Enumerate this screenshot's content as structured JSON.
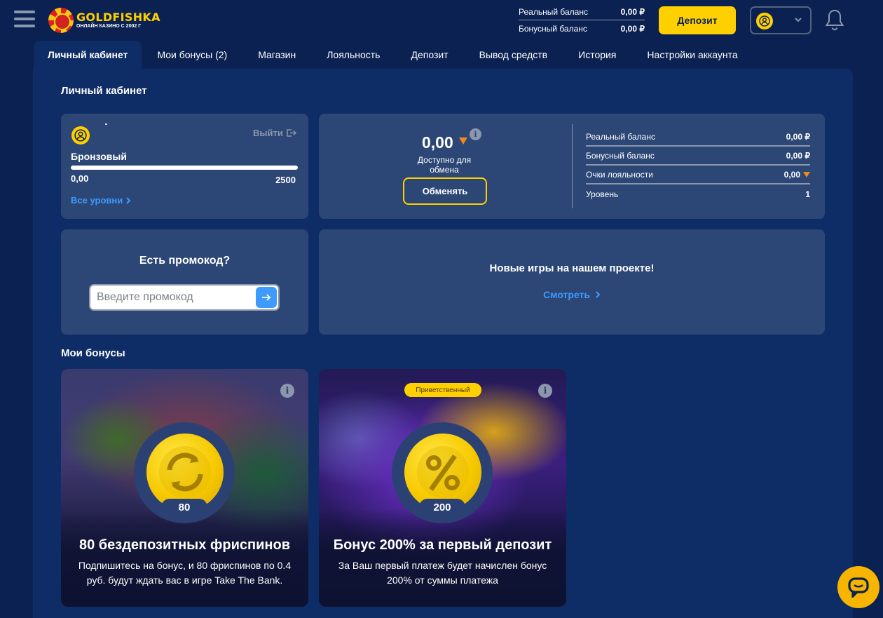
{
  "header": {
    "logo_name": "GOLDFISHKA",
    "logo_sub": "ОНЛАЙН КАЗИНО С 2002 Г",
    "real_balance_label": "Реальный баланс",
    "real_balance_value": "0,00 ₽",
    "bonus_balance_label": "Бонусный баланс",
    "bonus_balance_value": "0,00 ₽",
    "deposit_label": "Депозит"
  },
  "tabs": [
    {
      "label": "Личный кабинет",
      "active": true
    },
    {
      "label": "Мои бонусы (2)"
    },
    {
      "label": "Магазин"
    },
    {
      "label": "Лояльность"
    },
    {
      "label": "Депозит"
    },
    {
      "label": "Вывод средств"
    },
    {
      "label": "История"
    },
    {
      "label": "Настройки аккаунта"
    }
  ],
  "cabinet": {
    "title": "Личный кабинет",
    "logout_label": "Выйти",
    "level_name": "Бронзовый",
    "level_progress_fraction": 0,
    "level_min": "0,00",
    "level_max": "2500",
    "all_levels_label": "Все уровни"
  },
  "exchange": {
    "value": "0,00",
    "available_label": "Доступно для обмена",
    "button_label": "Обменять",
    "info_glyph": "i"
  },
  "stats": [
    {
      "label": "Реальный баланс",
      "value": "0,00 ₽"
    },
    {
      "label": "Бонусный баланс",
      "value": "0,00 ₽"
    },
    {
      "label": "Очки лояльности",
      "value": "0,00",
      "icon": "loyalty-triangle-icon"
    },
    {
      "label": "Уровень",
      "value": "1"
    }
  ],
  "promo": {
    "title": "Есть промокод?",
    "placeholder": "Введите промокод"
  },
  "newgames": {
    "title": "Новые игры на нашем проекте!",
    "link_label": "Смотреть"
  },
  "bonuses": {
    "title": "Мои бонусы",
    "items": [
      {
        "badge": "80",
        "title": "80 бездепозитных фриспинов",
        "description": "Подпишитесь на бонус, и 80 фриспинов по 0.4 руб. будут ждать вас в игре Take The Bank.",
        "icon": "refresh-icon"
      },
      {
        "tag": "Приветственный",
        "badge": "200",
        "title": "Бонус 200% за первый депозит",
        "description": "За Ваш первый платеж будет начислен бонус 200% от суммы платежа",
        "icon": "percent-icon"
      }
    ]
  },
  "colors": {
    "background": "#0a2152",
    "panel": "#0e2d66",
    "card": "#2c4776",
    "accent_yellow": "#ffd000",
    "link_blue": "#3d9bff"
  }
}
